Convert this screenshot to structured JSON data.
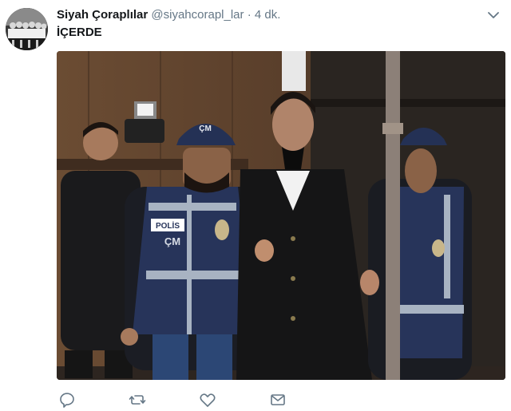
{
  "tweet": {
    "author_name": "Siyah Çoraplılar",
    "handle": "@siyahcorapl_lar",
    "separator": "·",
    "time": "4 dk.",
    "text": "İÇERDE"
  },
  "media": {
    "vest_label_polis": "POLİS",
    "vest_label_cm": "ÇM"
  },
  "icons": {
    "menu": "chevron-down-icon",
    "reply": "reply-icon",
    "retweet": "retweet-icon",
    "like": "heart-icon",
    "message": "envelope-icon"
  },
  "colors": {
    "icon_gray": "#657786",
    "text_dark": "#14171a",
    "vest_blue": "#27345a"
  }
}
